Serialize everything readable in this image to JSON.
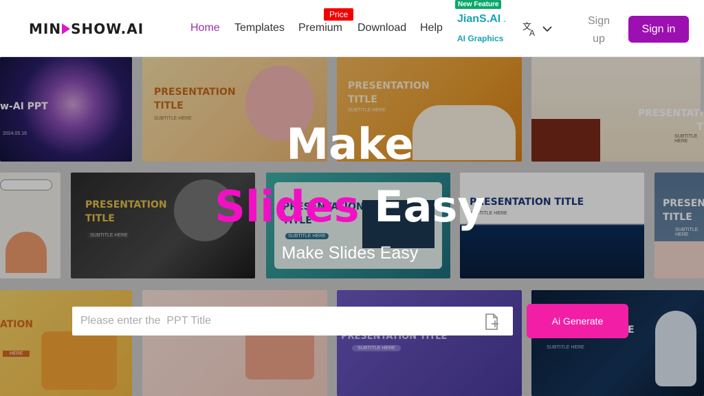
{
  "header": {
    "logo": {
      "left": "MIN",
      "right": "SHOW.AI"
    },
    "nav": [
      {
        "label": "Home",
        "active": true
      },
      {
        "label": "Templates",
        "active": false
      },
      {
        "label": "Premium",
        "active": false
      },
      {
        "label": "Download",
        "active": false
      },
      {
        "label": "Help",
        "active": false
      }
    ],
    "price_badge": "Price",
    "new_feature_badge": "New Feature",
    "jians_label": "JianS.AI",
    "jians_dash": "-",
    "ai_graphics_label": "AI Graphics",
    "language_icon": "translate-icon",
    "signup_line1": "Sign",
    "signup_line2": "up",
    "signin_label": "Sign in"
  },
  "hero": {
    "title_line1": "Make",
    "title_word_pink": "Slides",
    "title_word_white": "Easy",
    "subtitle": "Make Slides Easy"
  },
  "search": {
    "placeholder": "Please enter the  PPT Title",
    "upload_icon": "file-add-icon",
    "generate_label": "Ai Generate"
  },
  "tiles": [
    {
      "title": "w-AI PPT",
      "sub": "2024.05.16"
    },
    {
      "title": "PRESENTATION\nTITLE",
      "sub": "SUBTITLE HERE"
    },
    {
      "title": "PRESENTATION\nTITLE",
      "sub": "SUBTITLE HERE"
    },
    {
      "title": "PRESENTATION\nTITL",
      "sub": "SUBTITLE HERE"
    },
    {
      "title": "PRESENTATION\nTITLE",
      "sub": "SUBTITLE HERE"
    },
    {
      "title": "PRESENTATION\nTITLE",
      "sub": "SUBTITLE HERE"
    },
    {
      "title": "PRESENTATION TITLE",
      "sub": "SUBTITLE HERE"
    },
    {
      "title": "PRESEN\nTITLE",
      "sub": "SUBTITLE HERE"
    },
    {
      "title": "ATION",
      "sub": "HERE"
    },
    {
      "title": "PRESENTATION TITLE",
      "sub": "SUBTITLE HERE"
    },
    {
      "title": "E",
      "sub": "SUBTITLE HERE"
    }
  ],
  "colors": {
    "accent_purple": "#9c0fb1",
    "accent_pink": "#f20fc4",
    "generate_pink": "#f21ea6",
    "price_red": "#f40000",
    "new_feature_green": "#0aa86b",
    "jians_teal": "#14a3b9"
  }
}
